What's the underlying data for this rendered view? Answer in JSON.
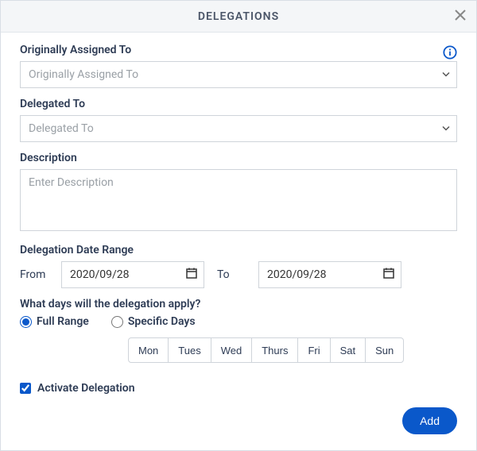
{
  "header": {
    "title": "DELEGATIONS"
  },
  "originally_assigned": {
    "label": "Originally Assigned To",
    "placeholder": "Originally Assigned To",
    "value": ""
  },
  "delegated_to": {
    "label": "Delegated To",
    "placeholder": "Delegated To",
    "value": ""
  },
  "description": {
    "label": "Description",
    "placeholder": "Enter Description",
    "value": ""
  },
  "date_range": {
    "label": "Delegation Date Range",
    "from_label": "From",
    "to_label": "To",
    "from_value": "2020/09/28",
    "to_value": "2020/09/28"
  },
  "days_apply": {
    "label": "What days will the delegation apply?",
    "full_range_label": "Full Range",
    "specific_days_label": "Specific Days",
    "selected": "full_range",
    "days": [
      "Mon",
      "Tues",
      "Wed",
      "Thurs",
      "Fri",
      "Sat",
      "Sun"
    ]
  },
  "activate": {
    "label": "Activate Delegation",
    "checked": true
  },
  "footer": {
    "add_label": "Add"
  }
}
